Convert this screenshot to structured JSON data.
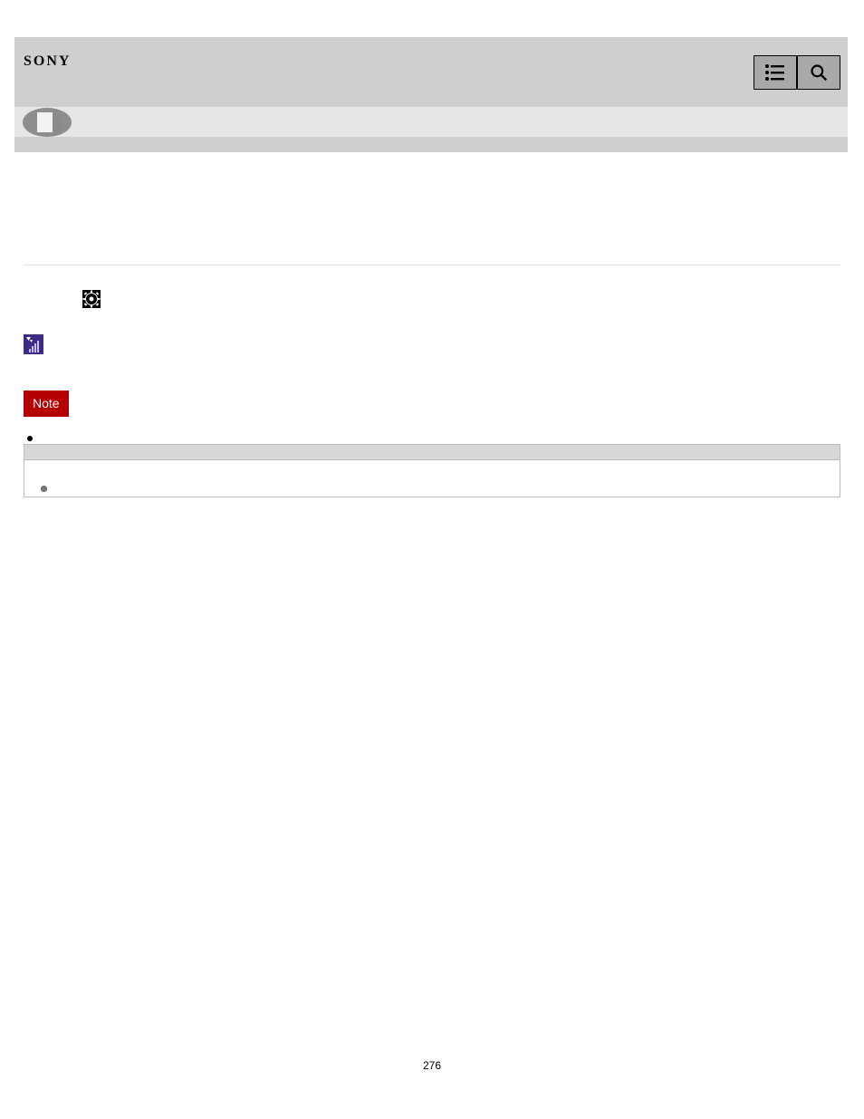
{
  "header": {
    "brand": "SONY",
    "menu_button_name": "menu",
    "search_button_name": "search"
  },
  "subheader": {
    "help_guide_icon": "pages-icon"
  },
  "content": {
    "gear_icon_name": "settings-gear-icon",
    "purple_icon_name": "auto-review-icon",
    "note_label": "Note",
    "note_items": [
      ""
    ]
  },
  "related": {
    "heading": "",
    "items": [
      "",
      "",
      "",
      ""
    ]
  },
  "page_number": "276"
}
